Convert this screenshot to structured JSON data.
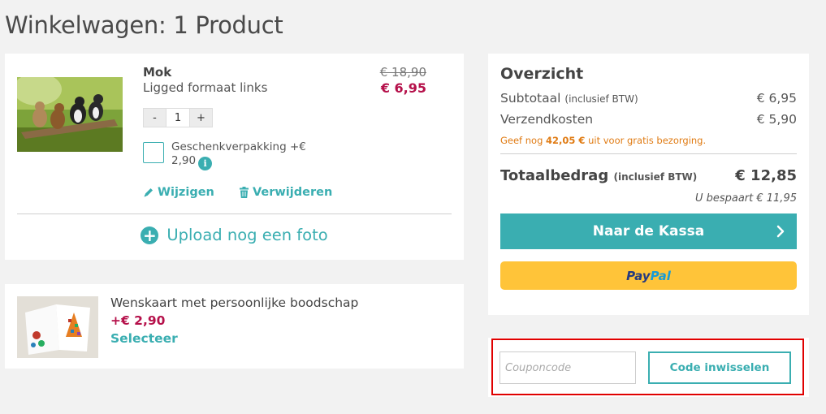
{
  "page": {
    "title": "Winkelwagen: 1 Product"
  },
  "product": {
    "name": "Mok",
    "variant": "Ligged formaat links",
    "price_old": "€ 18,90",
    "price_new": "€ 6,95",
    "quantity": "1",
    "qty_minus": "-",
    "qty_plus": "+",
    "gift_wrap_label": "Geschenkverpakking +€ 2,90",
    "info_icon": "i",
    "edit_label": "Wijzigen",
    "remove_label": "Verwijderen",
    "upload_label": "Upload nog een foto"
  },
  "greeting_card": {
    "title": "Wenskaart met persoonlijke boodschap",
    "price": "+€ 2,90",
    "select_label": "Selecteer"
  },
  "summary": {
    "title": "Overzicht",
    "subtotal_label": "Subtotaal",
    "subtotal_note": "(inclusief BTW)",
    "subtotal_value": "€ 6,95",
    "shipping_label": "Verzendkosten",
    "shipping_value": "€ 5,90",
    "free_shipping_prefix": "Geef nog",
    "free_shipping_amount": "42,05 €",
    "free_shipping_suffix": "uit voor gratis bezorging.",
    "total_label": "Totaalbedrag",
    "total_note": "(inclusief BTW)",
    "total_value": "€ 12,85",
    "savings": "U bespaart € 11,95",
    "checkout_label": "Naar de Kassa",
    "paypal_part1": "Pay",
    "paypal_part2": "Pal"
  },
  "coupon": {
    "placeholder": "Couponcode",
    "redeem_label": "Code inwisselen"
  },
  "colors": {
    "accent": "#3aaeb1",
    "price": "#b5104a",
    "shipping_note": "#e07b13",
    "paypal": "#ffc439",
    "highlight": "#e00000"
  },
  "icons": [
    "pencil-icon",
    "trash-icon",
    "plus-circle-icon",
    "info-icon",
    "chevron-right-icon"
  ]
}
